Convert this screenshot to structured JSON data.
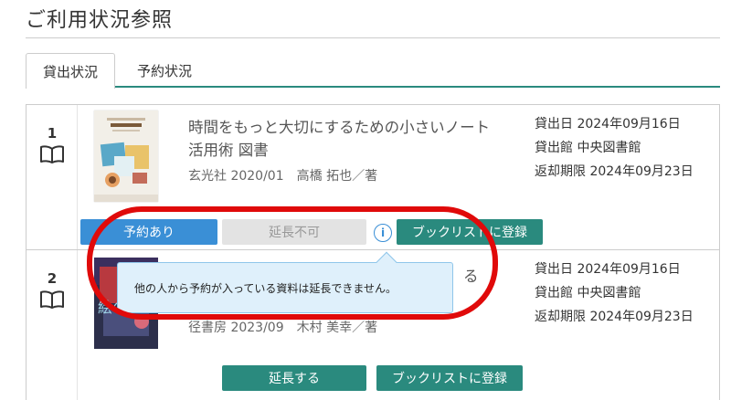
{
  "page": {
    "title": "ご利用状況参照"
  },
  "tabs": [
    {
      "label": "貸出状況",
      "active": true
    },
    {
      "label": "予約状況",
      "active": false
    }
  ],
  "loans": [
    {
      "number": "1",
      "title": "時間をもっと大切にするための小さいノート活用術 図書",
      "publisher_date": "玄光社 2020/01",
      "author": "高橋 拓也／著",
      "loan_date": "貸出日 2024年09月16日",
      "loan_library": "貸出館 中央図書館",
      "due_date": "返却期限 2024年09月23日",
      "status_label": "予約あり",
      "extend_label": "延長不可",
      "booklist_label": "ブックリストに登録",
      "info_icon_text": "i"
    },
    {
      "number": "2",
      "title_fragment": "る",
      "publisher_date": "径書房 2023/09",
      "author": "木村 美幸／著",
      "cover_text": "絵の",
      "loan_date": "貸出日 2024年09月16日",
      "loan_library": "貸出館 中央図書館",
      "due_date": "返却期限 2024年09月23日",
      "extend_label": "延長する",
      "booklist_label": "ブックリストに登録"
    }
  ],
  "tooltip": {
    "message": "他の人から予約が入っている資料は延長できません。"
  },
  "colors": {
    "accent_green": "#2a8a7e",
    "reserved_blue": "#3a8fd6",
    "highlight_red": "#e00a0a",
    "tooltip_bg": "#dff0fb"
  },
  "icons": {
    "book": "open-book-icon",
    "info": "info-icon"
  }
}
